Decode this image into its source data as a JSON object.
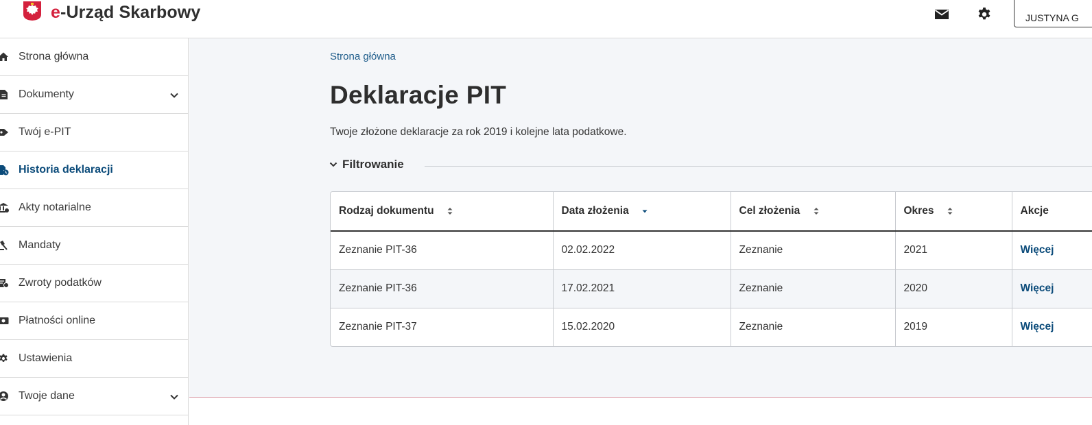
{
  "header": {
    "title_prefix": "e",
    "title_rest": "-Urząd Skarbowy",
    "user_label": "JUSTYNA G",
    "accent_color": "#d4213d",
    "icons": [
      "poland-emblem-icon",
      "mail-icon",
      "gear-icon"
    ]
  },
  "sidebar": {
    "items": [
      {
        "label": "Strona główna",
        "icon": "home-icon"
      },
      {
        "label": "Dokumenty",
        "icon": "document-icon",
        "expandable": true
      },
      {
        "label": "Twój e-PIT",
        "icon": "tag-icon"
      },
      {
        "label": "Historia deklaracji",
        "icon": "file-history-icon",
        "active": true
      },
      {
        "label": "Akty notarialne",
        "icon": "bank-icon"
      },
      {
        "label": "Mandaty",
        "icon": "gavel-icon"
      },
      {
        "label": "Zwroty podatków",
        "icon": "refund-icon"
      },
      {
        "label": "Płatności online",
        "icon": "money-icon"
      },
      {
        "label": "Ustawienia",
        "icon": "gear-icon"
      },
      {
        "label": "Twoje dane",
        "icon": "user-circle-icon",
        "expandable": true
      }
    ],
    "active_color": "#0b4b7a"
  },
  "main": {
    "breadcrumb": "Strona główna",
    "title": "Deklaracje PIT",
    "subtitle": "Twoje złożone deklaracje za rok 2019 i kolejne lata podatkowe.",
    "filter_label": "Filtrowanie",
    "table": {
      "headers": [
        "Rodzaj dokumentu",
        "Data złożenia",
        "Cel złożenia",
        "Okres",
        "Akcje"
      ],
      "sort": [
        "both",
        "desc",
        "both",
        "both",
        "none"
      ],
      "rows": [
        [
          "Zeznanie PIT-36",
          "02.02.2022",
          "Zeznanie",
          "2021",
          "Więcej"
        ],
        [
          "Zeznanie PIT-36",
          "17.02.2021",
          "Zeznanie",
          "2020",
          "Więcej"
        ],
        [
          "Zeznanie PIT-37",
          "15.02.2020",
          "Zeznanie",
          "2019",
          "Więcej"
        ]
      ]
    }
  }
}
